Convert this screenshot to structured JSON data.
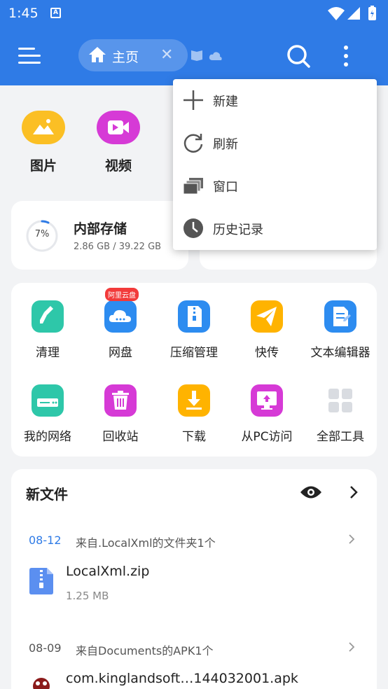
{
  "status_bar": {
    "time": "1:45",
    "notif_icon": "A"
  },
  "appbar": {
    "tab_label": "主页",
    "close_glyph": "✕"
  },
  "quick_access": [
    {
      "label": "图片",
      "color": "#fbbf24",
      "icon": "image-icon"
    },
    {
      "label": "视频",
      "color": "#d63ad6",
      "icon": "video-icon"
    }
  ],
  "storage": {
    "title": "内部存储",
    "percent": "7%",
    "percent_value": 0.07,
    "detail": "2.86 GB / 39.22 GB"
  },
  "tools": [
    {
      "label": "清理",
      "icon": "broom-icon",
      "color": "#2ec7a9"
    },
    {
      "label": "网盘",
      "icon": "cloud-icon",
      "color": "#2d8cf0",
      "badge": "阿里云盘"
    },
    {
      "label": "压缩管理",
      "icon": "zip-icon",
      "color": "#2d8cf0"
    },
    {
      "label": "快传",
      "icon": "send-icon",
      "color": "#ffb300"
    },
    {
      "label": "文本编辑器",
      "icon": "text-editor-icon",
      "color": "#2d8cf0"
    },
    {
      "label": "我的网络",
      "icon": "router-icon",
      "color": "#2ec7a9"
    },
    {
      "label": "回收站",
      "icon": "trash-icon",
      "color": "#d63ad6"
    },
    {
      "label": "下载",
      "icon": "download-icon",
      "color": "#ffb300"
    },
    {
      "label": "从PC访问",
      "icon": "pc-icon",
      "color": "#d63ad6"
    },
    {
      "label": "全部工具",
      "icon": "grid-icon",
      "color": "#dadde2"
    }
  ],
  "new_files": {
    "title": "新文件",
    "groups": [
      {
        "date": "08-12",
        "source": "来自.LocalXml的文件夹1个",
        "date_color": "#2f7be6",
        "file": {
          "name": "LocalXml.zip",
          "size": "1.25 MB"
        }
      },
      {
        "date": "08-09",
        "source": "来自Documents的APK1个",
        "date_color": "#555555",
        "file": {
          "name": "com.kinglandsoft…144032001.apk"
        }
      }
    ]
  },
  "popup_menu": [
    {
      "label": "新建",
      "icon": "plus-icon"
    },
    {
      "label": "刷新",
      "icon": "refresh-icon"
    },
    {
      "label": "窗口",
      "icon": "windows-icon"
    },
    {
      "label": "历史记录",
      "icon": "clock-icon"
    }
  ]
}
